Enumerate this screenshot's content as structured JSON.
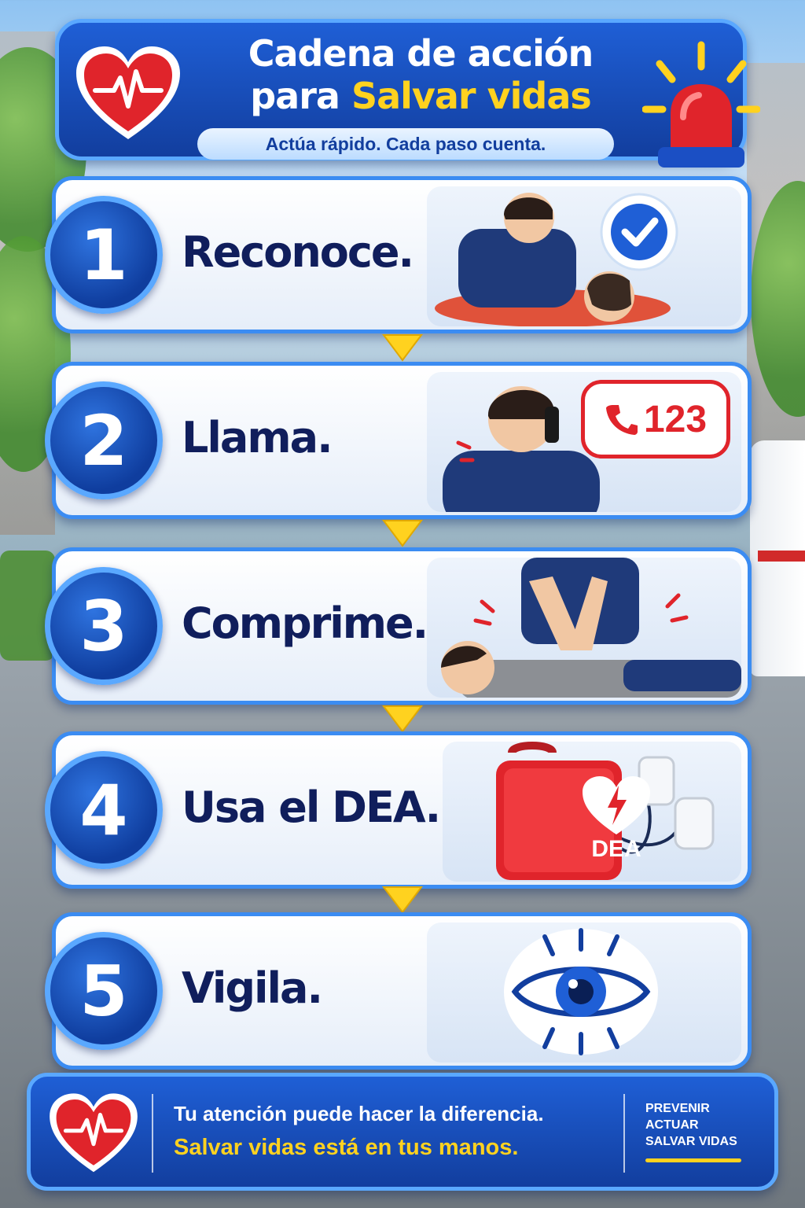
{
  "header": {
    "title_line1": "Cadena de acción",
    "title_line2_prefix": "para ",
    "title_line2_highlight": "Salvar vidas",
    "subtitle": "Actúa rápido. Cada paso cuenta."
  },
  "steps": [
    {
      "number": "1",
      "label": "Reconoce.",
      "icon": "check-bubble-icon"
    },
    {
      "number": "2",
      "label": "Llama.",
      "icon": "phone-bubble-icon",
      "badge": "123"
    },
    {
      "number": "3",
      "label": "Comprime.",
      "icon": "cpr-icon"
    },
    {
      "number": "4",
      "label": "Usa el DEA.",
      "icon": "defibrillator-icon",
      "badge": "DEA"
    },
    {
      "number": "5",
      "label": "Vigila.",
      "icon": "eye-icon"
    }
  ],
  "footer": {
    "line1": "Tu atención puede hacer la diferencia.",
    "line2": "Salvar vidas está en tus manos.",
    "tags": [
      "PREVENIR",
      "ACTUAR",
      "SALVAR VIDAS"
    ]
  },
  "colors": {
    "primary_blue": "#123e9e",
    "accent_blue": "#3b8cf2",
    "highlight_yellow": "#ffd21f",
    "alert_red": "#e0242b",
    "label_navy": "#101e5c"
  }
}
